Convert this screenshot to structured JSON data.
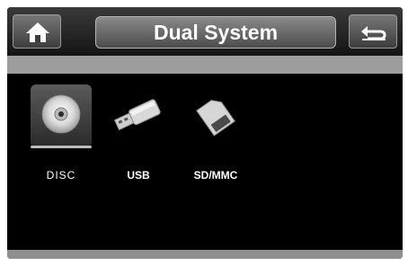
{
  "header": {
    "title": "Dual System",
    "home_icon": "home-icon",
    "back_icon": "back-arrow-icon"
  },
  "sources": [
    {
      "label": "DISC",
      "icon": "disc-icon",
      "selected": true
    },
    {
      "label": "USB",
      "icon": "usb-drive-icon",
      "selected": false
    },
    {
      "label": "SD/MMC",
      "icon": "sd-card-icon",
      "selected": false
    }
  ],
  "colors": {
    "background": "#000000",
    "titlebar": "#262626",
    "strip": "#9d9d9d",
    "text": "#ffffff"
  }
}
